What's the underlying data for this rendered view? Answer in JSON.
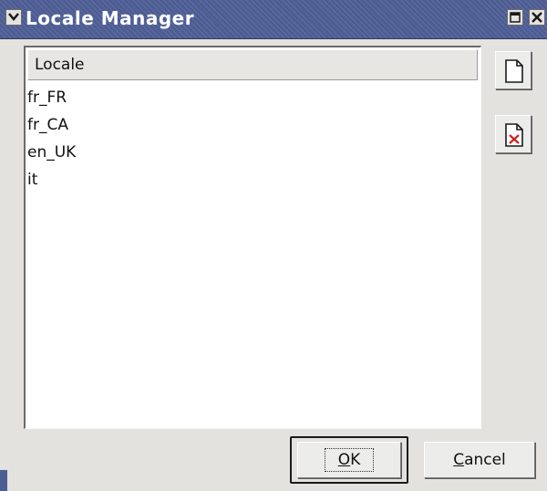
{
  "window": {
    "title": "Locale Manager"
  },
  "list": {
    "header": "Locale",
    "rows": [
      "fr_FR",
      "fr_CA",
      "en_UK",
      "it"
    ]
  },
  "toolbar": {
    "new_icon": "new-document-icon",
    "delete_icon": "delete-document-icon"
  },
  "buttons": {
    "ok_mnemonic": "O",
    "ok_rest": "K",
    "cancel_mnemonic": "C",
    "cancel_rest": "ancel"
  },
  "colors": {
    "titlebar": "#4d5d93",
    "window_bg": "#e4e2de",
    "delete_mark": "#cc2222"
  }
}
